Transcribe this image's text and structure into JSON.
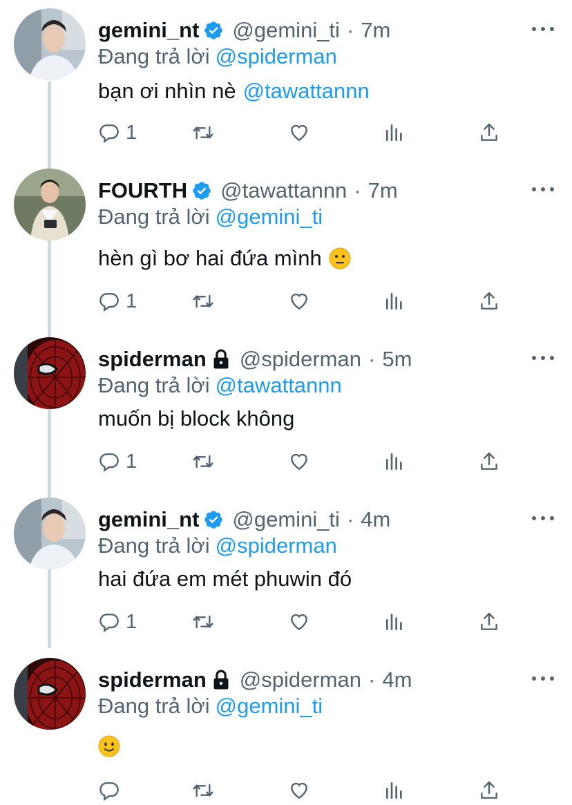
{
  "tweets": [
    {
      "name": "gemini_nt",
      "verified": true,
      "locked": false,
      "handle": "@gemini_ti",
      "time": "7m",
      "reply_label": "Đang trả lời",
      "reply_to": "@spiderman",
      "text": "bạn ơi nhìn nè",
      "text_mention": "@tawattannn",
      "emoji": "",
      "reply_count": "1",
      "avatar": "man-portrait-avatar"
    },
    {
      "name": "FOURTH",
      "verified": true,
      "locked": false,
      "handle": "@tawattannn",
      "time": "7m",
      "reply_label": "Đang trả lời",
      "reply_to": "@gemini_ti",
      "text": "hèn gì bơ hai đứa mình",
      "text_mention": "",
      "emoji": "neutral-face",
      "reply_count": "1",
      "avatar": "boy-with-camera-avatar"
    },
    {
      "name": "spiderman",
      "verified": false,
      "locked": true,
      "handle": "@spiderman",
      "time": "5m",
      "reply_label": "Đang trả lời",
      "reply_to": "@tawattannn",
      "text": "muốn bị block không",
      "text_mention": "",
      "emoji": "",
      "reply_count": "1",
      "avatar": "spiderman-mask-avatar"
    },
    {
      "name": "gemini_nt",
      "verified": true,
      "locked": false,
      "handle": "@gemini_ti",
      "time": "4m",
      "reply_label": "Đang trả lời",
      "reply_to": "@spiderman",
      "text": "hai đứa em mét phuwin đó",
      "text_mention": "",
      "emoji": "",
      "reply_count": "1",
      "avatar": "man-portrait-avatar"
    },
    {
      "name": "spiderman",
      "verified": false,
      "locked": true,
      "handle": "@spiderman",
      "time": "4m",
      "reply_label": "Đang trả lời",
      "reply_to": "@gemini_ti",
      "text": "",
      "text_mention": "",
      "emoji": "slight-smile",
      "reply_count": "",
      "avatar": "spiderman-mask-avatar"
    }
  ],
  "colors": {
    "link": "#1d9bf0",
    "muted": "#536471",
    "text": "#0f1419",
    "thread_line": "#cfd9de"
  },
  "icons": [
    "reply-icon",
    "retweet-icon",
    "like-icon",
    "analytics-icon",
    "share-icon",
    "verified-badge-icon",
    "lock-icon",
    "more-icon"
  ]
}
